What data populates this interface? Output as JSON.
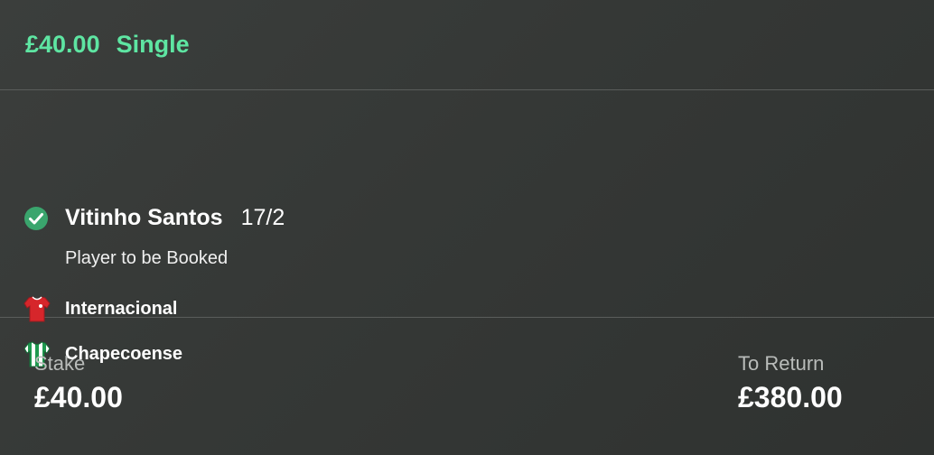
{
  "bet": {
    "amount": "£40.00",
    "type": "Single"
  },
  "selection": {
    "status_icon": "check-circle-icon",
    "name": "Vitinho Santos",
    "odds": "17/2",
    "market": "Player to be Booked"
  },
  "teams": [
    {
      "name": "Internacional",
      "icon": "red-shirt-icon",
      "color": "#d6262b"
    },
    {
      "name": "Chapecoense",
      "icon": "green-white-striped-shirt-icon",
      "color": "#1f9a4f"
    }
  ],
  "footer": {
    "stake_label": "Stake",
    "stake_value": "£40.00",
    "return_label": "To Return",
    "return_value": "£380.00"
  },
  "colors": {
    "accent": "#5ee5a2",
    "check": "#3aa56d",
    "background": "#353836"
  }
}
